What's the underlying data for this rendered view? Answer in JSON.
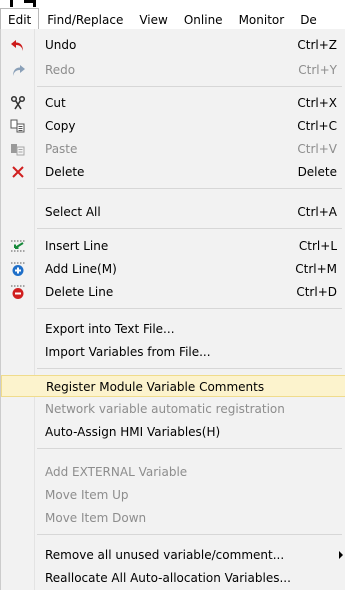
{
  "menubar": {
    "items": [
      {
        "label": "Edit"
      },
      {
        "label": "Find/Replace"
      },
      {
        "label": "View"
      },
      {
        "label": "Online"
      },
      {
        "label": "Monitor"
      },
      {
        "label": "De"
      }
    ]
  },
  "menu": {
    "items": [
      {
        "label": "Undo",
        "shortcut": "Ctrl+Z",
        "icon": "undo-icon"
      },
      {
        "label": "Redo",
        "shortcut": "Ctrl+Y",
        "icon": "redo-icon"
      },
      {
        "label": "Cut",
        "shortcut": "Ctrl+X",
        "icon": "scissors-icon"
      },
      {
        "label": "Copy",
        "shortcut": "Ctrl+C",
        "icon": "copy-icon"
      },
      {
        "label": "Paste",
        "shortcut": "Ctrl+V",
        "icon": "paste-icon"
      },
      {
        "label": "Delete",
        "shortcut": "Delete",
        "icon": "delete-icon"
      },
      {
        "label": "Select All",
        "shortcut": "Ctrl+A"
      },
      {
        "label": "Insert Line",
        "shortcut": "Ctrl+L",
        "icon": "insert-line-icon"
      },
      {
        "label": "Add Line(M)",
        "shortcut": "Ctrl+M",
        "icon": "add-line-icon"
      },
      {
        "label": "Delete Line",
        "shortcut": "Ctrl+D",
        "icon": "delete-line-icon"
      },
      {
        "label": "Export into Text File..."
      },
      {
        "label": "Import Variables from File..."
      },
      {
        "label": "Register Module Variable Comments"
      },
      {
        "label": "Network variable automatic registration"
      },
      {
        "label": "Auto-Assign HMI Variables(H)"
      },
      {
        "label": "Add EXTERNAL Variable"
      },
      {
        "label": "Move Item Up"
      },
      {
        "label": "Move Item Down"
      },
      {
        "label": "Remove all unused variable/comment..."
      },
      {
        "label": "Reallocate All Auto-allocation Variables..."
      }
    ]
  },
  "colors": {
    "highlight": "#fcf3cd",
    "disabled_text": "#8d8d8d",
    "undo_red": "#cc1a1a",
    "icon_blue": "#1f6fc8"
  }
}
